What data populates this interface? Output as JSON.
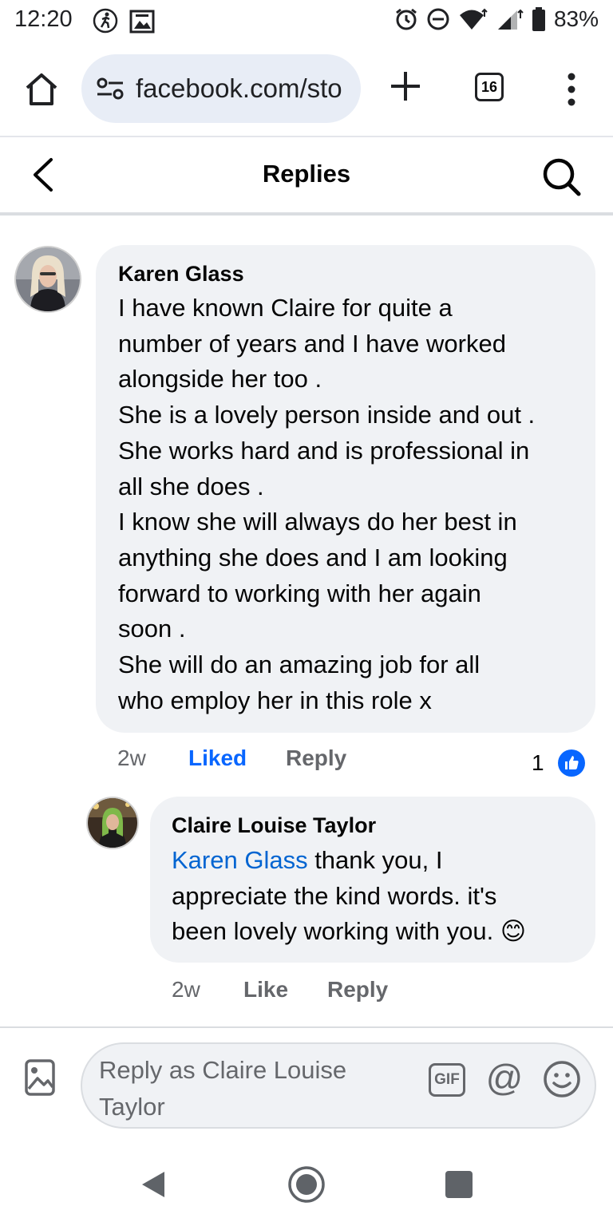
{
  "status_bar": {
    "time": "12:20",
    "battery": "83%"
  },
  "browser": {
    "url": "facebook.com/sto",
    "tab_count": "16"
  },
  "header": {
    "title": "Replies"
  },
  "comments": [
    {
      "author": "Karen Glass",
      "lines": [
        "I have known Claire for quite a",
        "number of years and I have worked",
        "alongside her too .",
        "She is a lovely person inside and out .",
        "She works hard and is professional in",
        "all she does .",
        "I know she will always do her best in",
        "anything she does and I am looking",
        "forward to working with her again",
        "soon .",
        "She will do an amazing job for all",
        "who employ her in this role x"
      ],
      "time": "2w",
      "like_label": "Liked",
      "reply_label": "Reply",
      "reaction_count": "1"
    },
    {
      "author": "Claire Louise Taylor",
      "mention": "Karen Glass",
      "line1_rest": " thank you, I",
      "line2": "appreciate the kind words. it's",
      "line3": "been lovely working with you. 😊",
      "time": "2w",
      "like_label": "Like",
      "reply_label": "Reply"
    }
  ],
  "composer": {
    "placeholder_line1": "Reply as Claire Louise",
    "placeholder_line2": "Taylor",
    "gif_label": "GIF",
    "at_label": "@"
  },
  "colors": {
    "link_blue": "#0866ff",
    "mention_blue": "#0064d1",
    "bubble_bg": "#f0f2f5",
    "meta_gray": "#65676b"
  }
}
